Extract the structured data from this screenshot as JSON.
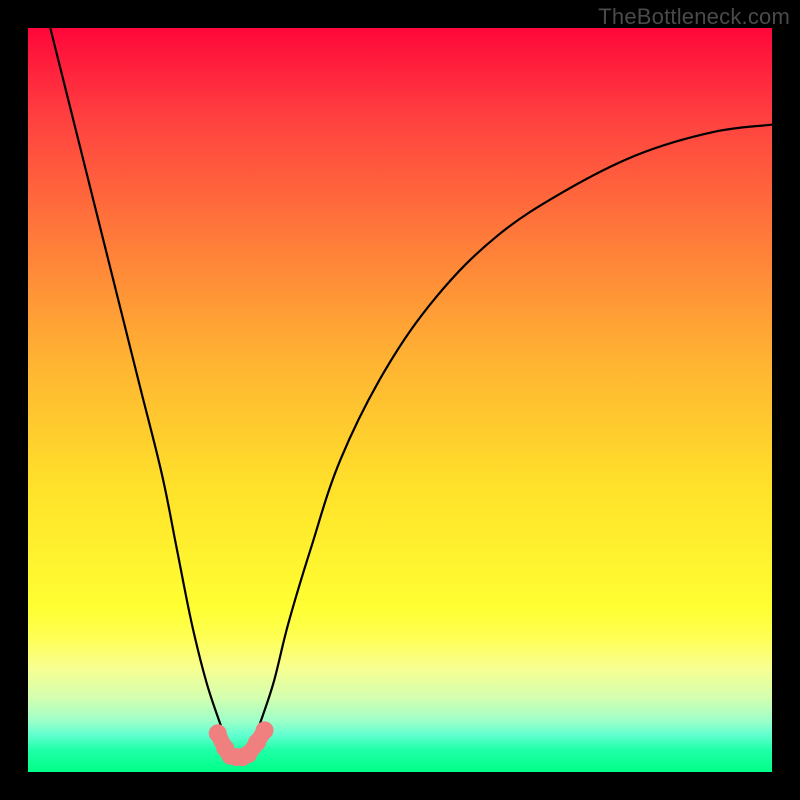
{
  "watermark": "TheBottleneck.com",
  "chart_data": {
    "type": "line",
    "title": "",
    "xlabel": "",
    "ylabel": "",
    "xlim": [
      0,
      100
    ],
    "ylim": [
      0,
      100
    ],
    "grid": false,
    "legend": false,
    "annotations": [],
    "x": [
      3,
      6,
      9,
      12,
      15,
      18,
      20,
      22,
      24,
      26,
      27,
      28,
      29,
      30,
      31,
      33,
      35,
      38,
      42,
      48,
      55,
      63,
      72,
      82,
      92,
      100
    ],
    "values": [
      100,
      88,
      76,
      64,
      52,
      40,
      30,
      20,
      12,
      6,
      3,
      2,
      2,
      3,
      6,
      12,
      20,
      30,
      42,
      54,
      64,
      72,
      78,
      83,
      86,
      87
    ],
    "marker_points": {
      "x": [
        25.5,
        26.5,
        27.2,
        28.0,
        28.8,
        29.6,
        30.8,
        31.8
      ],
      "y": [
        5.2,
        3.2,
        2.2,
        2.0,
        2.0,
        2.4,
        4.0,
        5.6
      ]
    },
    "marker_color": "#f08080",
    "curve_color": "#000000"
  }
}
